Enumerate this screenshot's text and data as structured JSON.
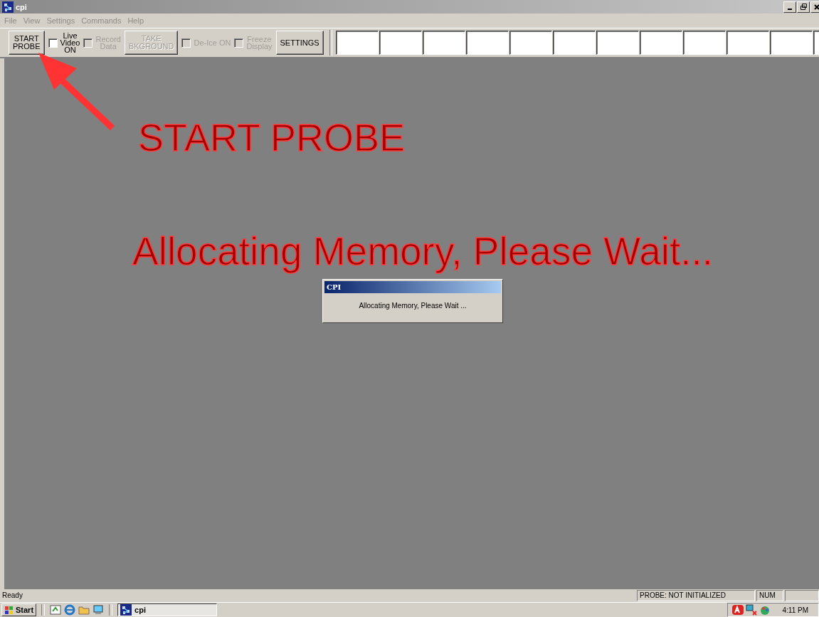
{
  "window": {
    "title": "cpi"
  },
  "menu": [
    {
      "label": "File",
      "disabled": true
    },
    {
      "label": "View",
      "disabled": true
    },
    {
      "label": "Settings",
      "disabled": true
    },
    {
      "label": "Commands",
      "disabled": true
    },
    {
      "label": "Help",
      "disabled": true
    }
  ],
  "toolbar": [
    {
      "kind": "button",
      "label": "START\nPROBE",
      "disabled": false
    },
    {
      "kind": "checkbox",
      "label": "Live\nVideo\nON",
      "checked": false,
      "disabled": false
    },
    {
      "kind": "checkbox",
      "label": "Record\nData",
      "checked": false,
      "disabled": true
    },
    {
      "kind": "button",
      "label": "TAKE\nBKGROUND",
      "disabled": true
    },
    {
      "kind": "checkbox",
      "label": "De-Ice ON",
      "checked": false,
      "disabled": true
    },
    {
      "kind": "checkbox",
      "label": "Freeze\nDisplay",
      "checked": false,
      "disabled": true
    },
    {
      "kind": "button",
      "label": "SETTINGS",
      "disabled": false
    }
  ],
  "annotations": [
    {
      "kind": "arrow"
    },
    {
      "kind": "text",
      "text": "START PROBE"
    },
    {
      "kind": "text",
      "text": "Allocating Memory, Please Wait..."
    }
  ],
  "dialog": {
    "title": "CPI",
    "message": "Allocating Memory, Please Wait ..."
  },
  "status_bar": [
    "Ready",
    "PROBE: NOT INITIALIZED",
    "NUM"
  ],
  "taskbar": {
    "start": "Start",
    "tasks": [
      {
        "label": "cpi",
        "selected": true
      }
    ],
    "clock": "4:11 PM"
  }
}
